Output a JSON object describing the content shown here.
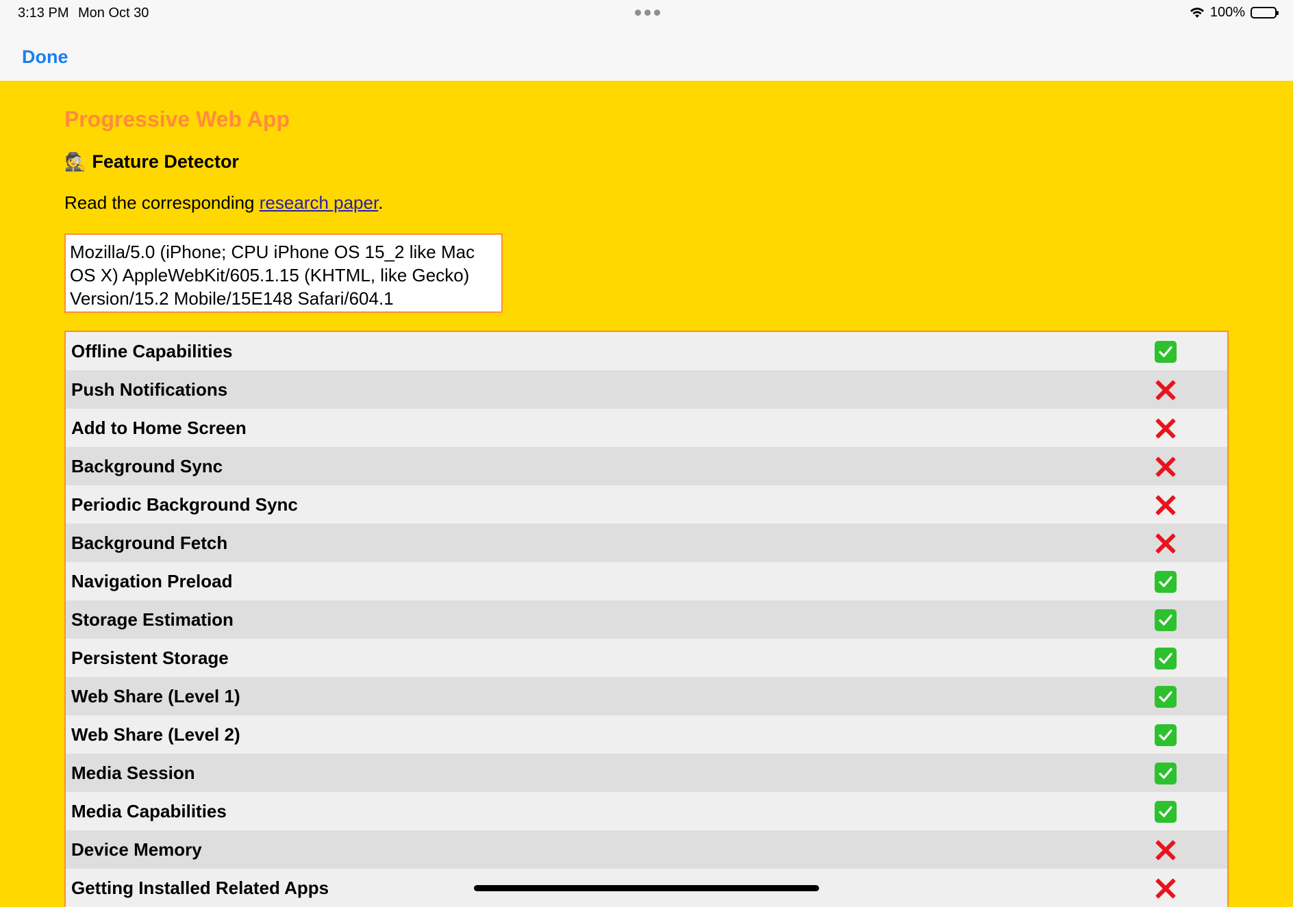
{
  "status_bar": {
    "time": "3:13 PM",
    "date": "Mon Oct 30",
    "battery": "100%"
  },
  "nav": {
    "done_label": "Done"
  },
  "page": {
    "title": "Progressive Web App",
    "subtitle_icon": "🕵️",
    "subtitle": "Feature Detector",
    "intro_prefix": "Read the corresponding ",
    "intro_link": "research paper",
    "intro_suffix": ".",
    "user_agent": "Mozilla/5.0 (iPhone; CPU iPhone OS 15_2 like Mac OS X) AppleWebKit/605.1.15 (KHTML, like Gecko) Version/15.2 Mobile/15E148 Safari/604.1"
  },
  "colors": {
    "background": "#ffd800",
    "title": "#ff8a3d",
    "link": "#2a1ea8",
    "done": "#1a7ef0",
    "supported": "#2ec12e",
    "unsupported": "#e8141c"
  },
  "features": [
    {
      "name": "Offline Capabilities",
      "supported": true
    },
    {
      "name": "Push Notifications",
      "supported": false
    },
    {
      "name": "Add to Home Screen",
      "supported": false
    },
    {
      "name": "Background Sync",
      "supported": false
    },
    {
      "name": "Periodic Background Sync",
      "supported": false
    },
    {
      "name": "Background Fetch",
      "supported": false
    },
    {
      "name": "Navigation Preload",
      "supported": true
    },
    {
      "name": "Storage Estimation",
      "supported": true
    },
    {
      "name": "Persistent Storage",
      "supported": true
    },
    {
      "name": "Web Share (Level 1)",
      "supported": true
    },
    {
      "name": "Web Share (Level 2)",
      "supported": true
    },
    {
      "name": "Media Session",
      "supported": true
    },
    {
      "name": "Media Capabilities",
      "supported": true
    },
    {
      "name": "Device Memory",
      "supported": false
    },
    {
      "name": "Getting Installed Related Apps",
      "supported": false
    }
  ]
}
